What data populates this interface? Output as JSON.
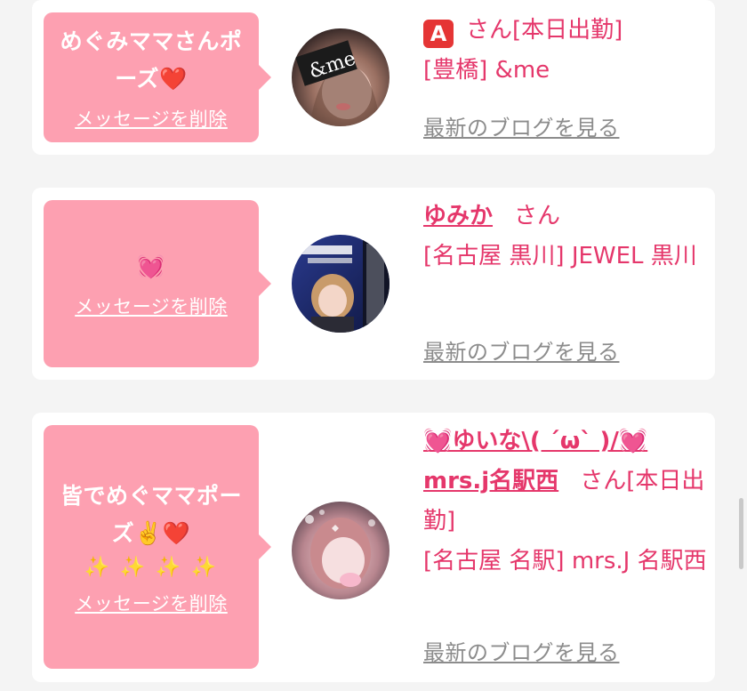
{
  "cards": [
    {
      "message_lines": [
        "めぐみママさんポ",
        "ーズ"
      ],
      "message_emoji": "❤️",
      "delete_label": "メッセージを削除",
      "badge": "A",
      "name": "",
      "suffix": "さん[本日出勤]",
      "shop": "[豊橋] &me",
      "blog_label": "最新のブログを見る"
    },
    {
      "message_lines": [],
      "message_emoji": "💓",
      "delete_label": "メッセージを削除",
      "name": "ゆみか",
      "suffix": "さん",
      "shop": "[名古屋 黒川] JEWEL 黒川",
      "blog_label": "最新のブログを見る"
    },
    {
      "message_lines": [
        "皆でめぐママポー",
        "ズ✌️"
      ],
      "message_emoji": "❤️",
      "message_sparkles": "✨ ✨ ✨ ✨",
      "delete_label": "メッセージを削除",
      "name": "💓ゆいな\\( ´ω` )/💓mrs.j名駅西",
      "suffix": "さん[本日出勤]",
      "shop": "[名古屋 名駅] mrs.J 名駅西",
      "blog_label": "最新のブログを見る"
    }
  ],
  "colors": {
    "bubble": "#fda0b1",
    "accent": "#e5376b",
    "link_gray": "#8c8c8c",
    "background": "#f4f4f4"
  }
}
